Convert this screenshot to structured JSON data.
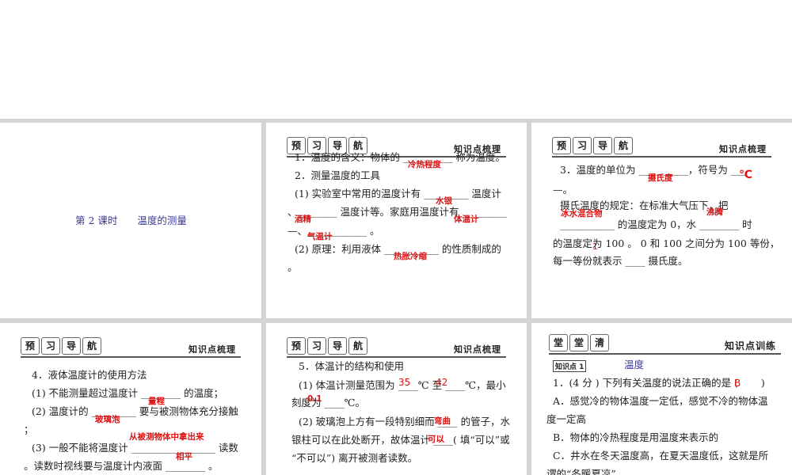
{
  "slide1": {
    "title": "第 2 课时　　温度的测量"
  },
  "header": {
    "preview_badge": [
      "预",
      "习",
      "导",
      "航"
    ],
    "preview_label": "知识点梳理",
    "practice_badge": [
      "堂",
      "堂",
      "清"
    ],
    "practice_label": "知识点训练"
  },
  "slide2": {
    "lines": [
      "1．温度的含义：物体的 __________ 称为温度。",
      "2．测量温度的工具",
      "(1) 实验室中常用的温度计有 _________ 温度计",
      "、________ 温度计等。家庭用温度计有 _________",
      "—、____________ 。",
      "(2) 原理：利用液体 ___________ 的性质制成的",
      "。"
    ],
    "answers": [
      "冷热程度",
      "水银",
      "酒精",
      "体温计",
      "气温计",
      "热胀冷缩"
    ]
  },
  "slide3": {
    "lines": [
      "3．温度的单位为 __________，符号为 ___",
      "—。",
      "摄氏温度的规定：在标准大气压下，把",
      "___________ 的温度定为 0，水 ________ 时",
      "的温度定为 100 。 0 和 100 之间分为 100 等份，",
      "每一等份就表示 ____ 摄氏度。"
    ],
    "answers": [
      "摄氏度",
      "℃",
      "冰水混合物",
      "沸腾",
      "1"
    ]
  },
  "slide4": {
    "lines": [
      "4．液体温度计的使用方法",
      "(1) 不能测量超过温度计 ________ 的温度；",
      "(2) 温度计的 _________ 要与被测物体充分接触",
      "；",
      "(3) 一般不能将温度计 _________________ 读数",
      "。读数时视线要与温度计内液面 ________ 。"
    ],
    "answers": [
      "量程",
      "玻璃泡",
      "从被测物体中拿出来",
      "相平"
    ]
  },
  "slide5": {
    "lines": [
      "5．体温计的结构和使用",
      "(1) 体温计测量范围为 ____℃ 至 ____℃，最小",
      "刻度为 ____℃。",
      "(2) 玻璃泡上方有一段特别细而 ____ 的管子，水",
      "银柱可以在此处断开，故体温计 ____( 填“可以”或",
      "“不可以”) 离开被测者读数。"
    ],
    "answers": [
      "35",
      "42",
      "0.1",
      "弯曲",
      "可以"
    ]
  },
  "slide6": {
    "tag": "知识点 1",
    "topic": "温度",
    "lines": [
      "1．(4 分 ) 下列有关温度的说法正确的是 (　　 )",
      "A．感觉冷的物体温度一定低，感觉不冷的物体温",
      "度一定高",
      "B．物体的冷热程度是用温度来表示的",
      "C．井水在冬天温度高，在夏天温度低，这就是所",
      "谓的“冬暖夏凉”"
    ],
    "answer": "B"
  }
}
